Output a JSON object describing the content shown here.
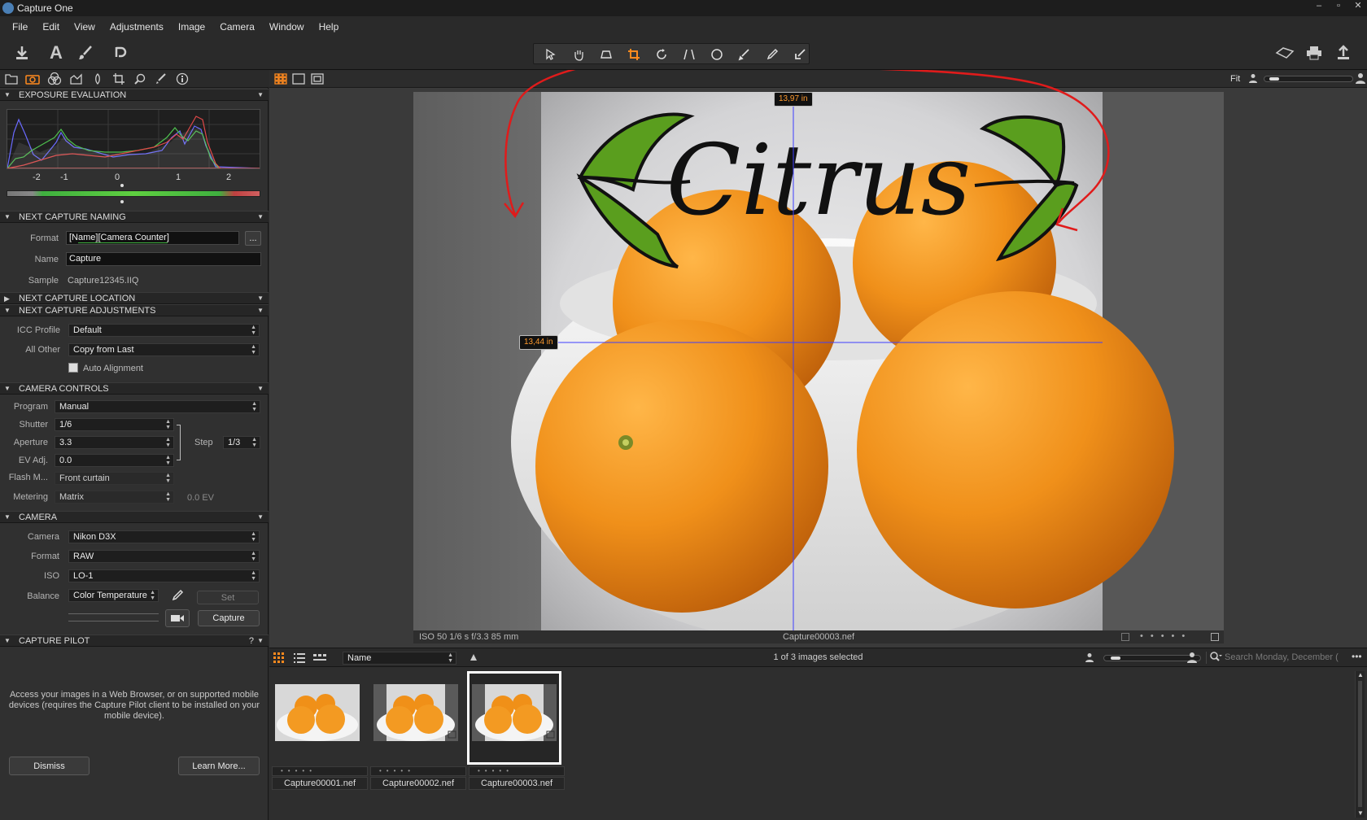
{
  "titlebar": {
    "title": "Capture One",
    "minimize": "–",
    "maximize": "▫",
    "close": "✕"
  },
  "menu": [
    "File",
    "Edit",
    "View",
    "Adjustments",
    "Image",
    "Camera",
    "Window",
    "Help"
  ],
  "left_panel": {
    "exposure": {
      "header": "EXPOSURE EVALUATION",
      "ticks": [
        "-2",
        "-1",
        "0",
        "1",
        "2"
      ]
    },
    "naming": {
      "header": "NEXT CAPTURE NAMING",
      "format_label": "Format",
      "format_value": "[Name][Camera Counter]",
      "format_more": "...",
      "name_label": "Name",
      "name_value": "Capture",
      "sample_label": "Sample",
      "sample_value": "Capture12345.IIQ"
    },
    "location_header": "NEXT CAPTURE LOCATION",
    "adjustments": {
      "header": "NEXT CAPTURE ADJUSTMENTS",
      "icc_label": "ICC Profile",
      "icc_value": "Default",
      "allother_label": "All Other",
      "allother_value": "Copy from Last",
      "autoalign_label": "Auto Alignment"
    },
    "camera_controls": {
      "header": "CAMERA CONTROLS",
      "program_label": "Program",
      "program_value": "Manual",
      "shutter_label": "Shutter",
      "shutter_value": "1/6",
      "aperture_label": "Aperture",
      "aperture_value": "3.3",
      "ev_label": "EV Adj.",
      "ev_value": "0.0",
      "step_label": "Step",
      "step_value": "1/3",
      "flash_label": "Flash M...",
      "flash_value": "Front curtain",
      "metering_label": "Metering",
      "metering_value": "Matrix",
      "metering_readout": "0.0 EV"
    },
    "camera": {
      "header": "CAMERA",
      "camera_label": "Camera",
      "camera_value": "Nikon D3X",
      "format_label": "Format",
      "format_value": "RAW",
      "iso_label": "ISO",
      "iso_value": "LO-1",
      "balance_label": "Balance",
      "balance_value": "Color Temperature",
      "set_label": "Set",
      "capture_label": "Capture"
    },
    "pilot": {
      "header": "CAPTURE PILOT",
      "help": "?",
      "description": "Access your images in a Web Browser, or on supported mobile devices (requires the Capture Pilot client to be installed on your mobile device).",
      "dismiss_label": "Dismiss",
      "learn_label": "Learn More..."
    }
  },
  "viewer": {
    "zoom_label": "Fit",
    "width_readout": "13,97 in",
    "height_readout": "13,44 in",
    "status_left": "ISO 50  1/6 s  f/3.3  85 mm",
    "status_file": "Capture00003.nef",
    "overlay_text": "Citrus"
  },
  "browser": {
    "sort_value": "Name",
    "selection_status": "1 of 3 images selected",
    "search_placeholder": "Search Monday, December (",
    "thumbnails": [
      {
        "name": "Capture00001.nef",
        "selected": false
      },
      {
        "name": "Capture00002.nef",
        "selected": false
      },
      {
        "name": "Capture00003.nef",
        "selected": true
      }
    ]
  },
  "colors": {
    "accent": "#ff9a2e",
    "annotation": "#e01b1b",
    "leaf": "#5a9e1e"
  }
}
